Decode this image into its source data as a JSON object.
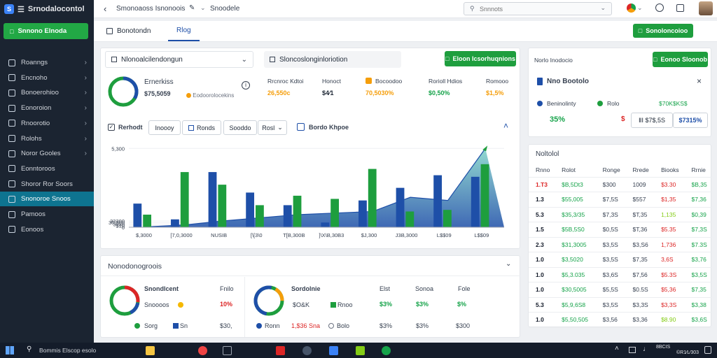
{
  "app": {
    "title": "Srnodalocontol",
    "cta": "Snnono Elnoda"
  },
  "colors": {
    "green": "#1e9e3e",
    "blue": "#1e4fa8",
    "teal": "#5ab9b3",
    "red": "#dc2626",
    "orange": "#f59e0b",
    "sidebar": "#1b2431"
  },
  "sidebar": {
    "items": [
      {
        "label": "Roanngs",
        "chevron": true
      },
      {
        "label": "Encnoho",
        "chevron": true
      },
      {
        "label": "Bonoerohioo",
        "chevron": true
      },
      {
        "label": "Eonoroion",
        "chevron": true
      },
      {
        "label": "Rnoorotio",
        "chevron": true
      },
      {
        "label": "Rolohs",
        "chevron": true
      },
      {
        "label": "Noror Gooles",
        "chevron": true
      },
      {
        "label": "Eonntoroos",
        "chevron": false
      },
      {
        "label": "Shoror Ror Soors",
        "chevron": false
      },
      {
        "label": "Snonoroe Snoos",
        "chevron": false
      },
      {
        "label": "Pamoos",
        "chevron": false
      },
      {
        "label": "Eonoos",
        "chevron": false
      }
    ],
    "active_index": 9
  },
  "topbar": {
    "breadcrumb": "Smonoaoss Isnonoois",
    "crumb_sub": "Snoodele",
    "search_placeholder": "Snnnots"
  },
  "tabs": {
    "items": [
      "Bonotondn",
      "Rlog"
    ],
    "active_index": 1,
    "action": "Sonoloncoioo"
  },
  "portfolio": {
    "dropdown": "Nlonoalcilendongun",
    "name": "Ernerkiss",
    "value": "$75,5059",
    "sub": "Eodoorolocekins"
  },
  "metrics": {
    "header": "Sloncoslonginloriotion",
    "button": "Eloon Icsorhuqnions",
    "items": [
      {
        "label": "Rrcnroc Kdtoi",
        "value": "26,550c",
        "color": "#f59e0b"
      },
      {
        "label": "Honoct",
        "value": "$4⁄1",
        "color": "#1f2937"
      },
      {
        "label": "Bocoodoo",
        "value": "70,5030%",
        "color": "#f59e0b"
      },
      {
        "label": "Rorioll Hdios",
        "value": "$0,50%",
        "color": "#16a34a"
      },
      {
        "label": "Romooo",
        "value": "$1,5%",
        "color": "#f59e0b"
      }
    ]
  },
  "chart_toolbar": {
    "check_label": "Rerhodt",
    "buttons": [
      "Inoooy",
      "Ronds",
      "Sooddo",
      "Rosl"
    ],
    "legend": "Bordo Khpoe"
  },
  "chart_data": {
    "type": "bar",
    "title": "",
    "categories": [
      "$,3000",
      "[7,0,3000",
      "NUSIB",
      "[\\[3\\0",
      "T[B,300B",
      "]\\X\\B,30B3",
      "$J,300",
      "J3B,3000",
      "L$$09",
      "L$$09"
    ],
    "y_ticks": [
      0,
      100,
      200,
      300,
      400,
      5000
    ],
    "y_tick_labels": [
      "0",
      "$10",
      "3030",
      "30,500",
      "33300",
      "5,300"
    ],
    "ylim": [
      0,
      5500
    ],
    "series": [
      {
        "name": "",
        "type": "bar",
        "color": "#1e4fa8",
        "values": [
          1500,
          500,
          3500,
          2200,
          1400,
          300,
          1700,
          2500,
          3300,
          3200
        ]
      },
      {
        "name": "",
        "type": "bar",
        "color": "#1e9e3e",
        "values": [
          800,
          3500,
          2700,
          1400,
          2000,
          1800,
          3700,
          1000,
          1100,
          4000
        ]
      },
      {
        "name": "",
        "type": "area",
        "color": "#5ab9b3",
        "values": [
          30,
          150,
          400,
          600,
          800,
          900,
          1000,
          1900,
          1700,
          5000
        ]
      }
    ]
  },
  "side_panel": {
    "button": "Eonoo Sloonob",
    "title": "Nno Bootolo",
    "rows": [
      {
        "label": "Beninolinty",
        "color": "#1e4fa8"
      },
      {
        "label": "Rolo",
        "color": "#1e9e3e"
      },
      {
        "label": "$70K$KS$",
        "color": "#16a34a"
      }
    ],
    "values": [
      "35%",
      "$",
      "ⅡⅠ $7$,5S",
      "$7315%"
    ]
  },
  "table": {
    "title": "Noltolol",
    "headers": [
      "Rnno",
      "Rolot",
      "Ronge",
      "Rrede",
      "Biooks",
      "Rrnie"
    ],
    "rows": [
      [
        "1.T3",
        "$B,5Dt3",
        "$300",
        "1009",
        "$3.30",
        "$B,35"
      ],
      [
        "1.3",
        "$55,005",
        "$7,5S",
        "$557",
        "$1,35",
        "$7,36"
      ],
      [
        "5.3",
        "$35,3/35",
        "$7,3S",
        "$T,35",
        "1,135",
        "$0,39"
      ],
      [
        "1.5",
        "$5B,5S0",
        "$0,5S",
        "$T,36",
        "$5.35",
        "$7,3S"
      ],
      [
        "2.3",
        "$31,3005",
        "$3,5S",
        "$3,S6",
        "1,736",
        "$7.3S"
      ],
      [
        "1.0",
        "$3,5020",
        "$3,5S",
        "$7,35",
        "3,6S",
        "$3,76"
      ],
      [
        "1.0",
        "$5,3.035",
        "$3,6S",
        "$7,56",
        "$5.3S",
        "$3,5S"
      ],
      [
        "1.0",
        "$30,5005",
        "$5,5S",
        "$0.5S",
        "$5,36",
        "$7,35"
      ],
      [
        "5.3",
        "$5,9,6S8",
        "$3,5S",
        "$3,3S",
        "$3,3S",
        "$3,38"
      ],
      [
        "1.0",
        "$5,50,505",
        "$3,56",
        "$3,36",
        "$8.90",
        "$3,6S"
      ]
    ],
    "col_colors": [
      "#111827",
      "#16a34a",
      "#374151",
      "#374151",
      "#dc2626",
      "#16a34a"
    ]
  },
  "bottom": {
    "title": "Nonodonogroois",
    "left": {
      "title": "Snondlcent",
      "col": "Fnilo",
      "sub": "Snoooos",
      "pct": "10%",
      "legend1": "Sorg",
      "legend2": "Sn",
      "val": "$30,"
    },
    "right": {
      "title": "Sordolnie",
      "col1": "Elst",
      "col2": "Sonoa",
      "col3": "Fole",
      "v0": "$O&K",
      "v1": "Rnoo",
      "v2": "$3%",
      "v3": "$3%",
      "v4": "$%",
      "l1": "Ronn",
      "l2": "1,$36 Sna",
      "l3": "Bolo",
      "p1": "$3%",
      "p2": "$3%",
      "p3": "$300"
    }
  },
  "taskbar": {
    "search": "Bommis Elscop esolo",
    "time": "8BCIS",
    "date": "©R1⁄L⁄303"
  }
}
